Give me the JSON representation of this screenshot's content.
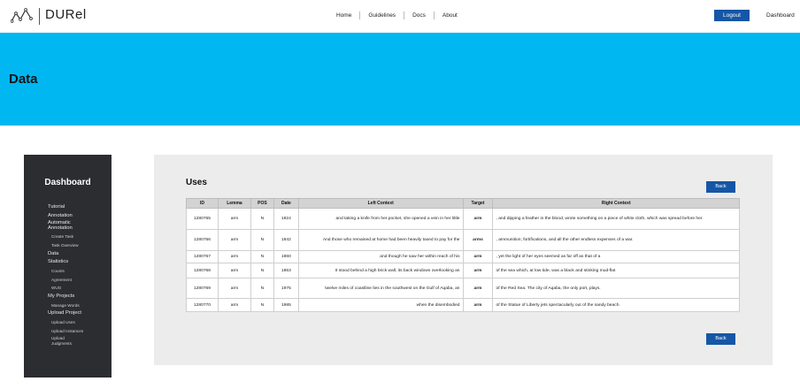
{
  "header": {
    "brand": "DURel",
    "nav": [
      "Home",
      "Guidelines",
      "Docs",
      "About"
    ],
    "logout_label": "Logout",
    "dashboard_label": "Dashboard"
  },
  "hero": {
    "title": "Data"
  },
  "sidebar": {
    "title": "Dashboard",
    "items": [
      {
        "label": "Tutorial",
        "level": "top"
      },
      {
        "label": "Annotation",
        "level": "top"
      },
      {
        "label": "Automatic Annotation",
        "level": "top"
      },
      {
        "label": "Create Task",
        "level": "sub"
      },
      {
        "label": "Task Overview",
        "level": "sub"
      },
      {
        "label": "Data",
        "level": "top"
      },
      {
        "label": "Statistics",
        "level": "top"
      },
      {
        "label": "Counts",
        "level": "sub"
      },
      {
        "label": "Agreement",
        "level": "sub"
      },
      {
        "label": "WUG",
        "level": "sub"
      },
      {
        "label": "My Projects",
        "level": "top"
      },
      {
        "label": "Manage Words",
        "level": "sub"
      },
      {
        "label": "Upload Project",
        "level": "top"
      },
      {
        "label": "Upload Uses",
        "level": "sub"
      },
      {
        "label": "Upload Instances",
        "level": "sub"
      },
      {
        "label": "Upload Judgments",
        "level": "sub"
      }
    ]
  },
  "main": {
    "title": "Uses",
    "back_label": "Back",
    "columns": [
      "ID",
      "Lemma",
      "POS",
      "Date",
      "Left Context",
      "Target",
      "Right Context"
    ],
    "rows": [
      [
        "1280765",
        "arm",
        "N",
        "1824",
        "and taking a knife from her pocket, she opened a vein in her little",
        "arm",
        ", and dipping a feather in the blood, wrote something on a piece of white cloth, which was spread before her."
      ],
      [
        "1280766",
        "arm",
        "N",
        "1842",
        "And those who remained at home had been heavily taxed to pay for the",
        "arms",
        ", ammunition; fortifications, and all the other endless expenses of a war."
      ],
      [
        "1280767",
        "arm",
        "N",
        "1860",
        "and though he saw her within reach of his",
        "arm",
        ", yet the light of her eyes seemed as far off as that of a"
      ],
      [
        "1280768",
        "arm",
        "N",
        "1853",
        "It stood behind a high brick wall, its back windows overlooking an",
        "arm",
        "of the sea which, at low tide, was a black and stinking mud-flat"
      ],
      [
        "1280769",
        "arm",
        "N",
        "1975",
        "twelve miles of coastline lies in the southwest on the Gulf of Aqaba, an",
        "arm",
        "of the Red Sea. The city of Aqaba, the only port, plays."
      ],
      [
        "1280770",
        "arm",
        "N",
        "1985",
        "when the disembodied",
        "arm",
        "of the Statue of Liberty jets spectacularly out of the sandy beach."
      ]
    ]
  }
}
